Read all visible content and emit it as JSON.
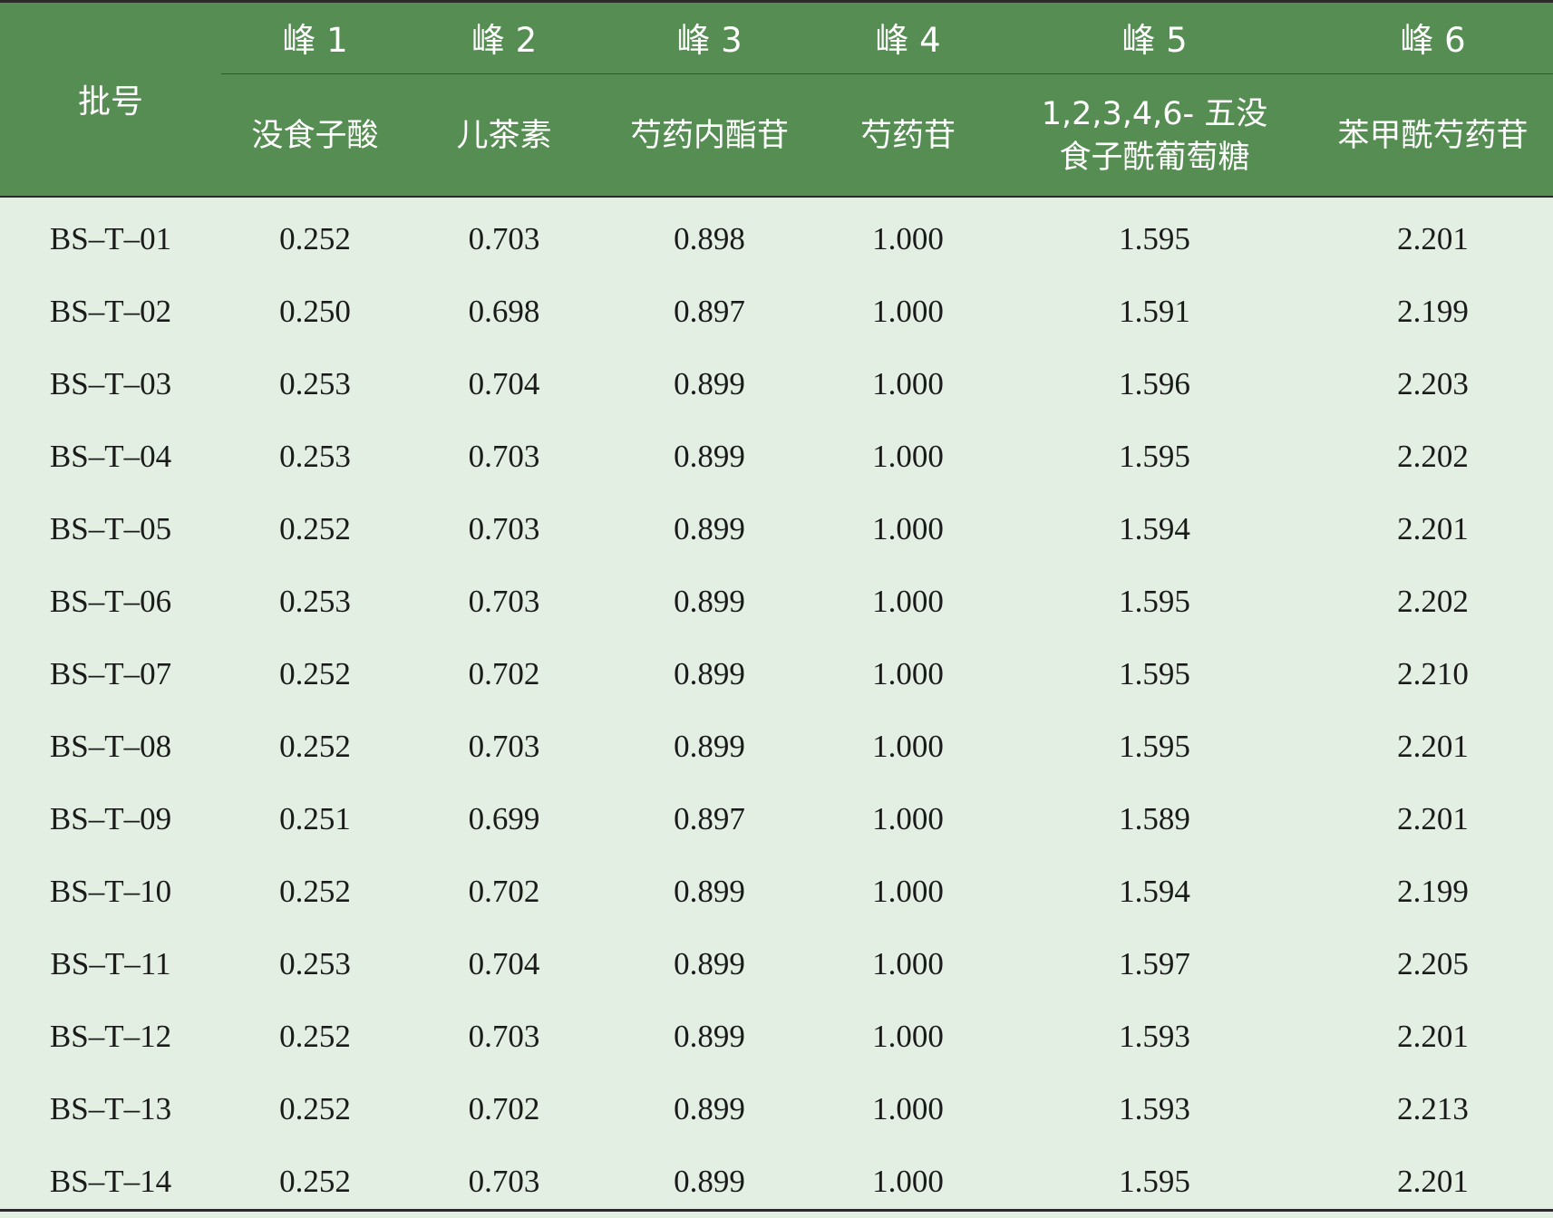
{
  "table": {
    "batch_header": "批号",
    "peaks": [
      "峰 1",
      "峰 2",
      "峰 3",
      "峰 4",
      "峰 5",
      "峰 6"
    ],
    "compounds": [
      "没食子酸",
      "儿茶素",
      "芍药内酯苷",
      "芍药苷",
      "1,2,3,4,6- 五没\n食子酰葡萄糖",
      "苯甲酰芍药苷"
    ],
    "rows": [
      [
        "BS–T–01",
        "0.252",
        "0.703",
        "0.898",
        "1.000",
        "1.595",
        "2.201"
      ],
      [
        "BS–T–02",
        "0.250",
        "0.698",
        "0.897",
        "1.000",
        "1.591",
        "2.199"
      ],
      [
        "BS–T–03",
        "0.253",
        "0.704",
        "0.899",
        "1.000",
        "1.596",
        "2.203"
      ],
      [
        "BS–T–04",
        "0.253",
        "0.703",
        "0.899",
        "1.000",
        "1.595",
        "2.202"
      ],
      [
        "BS–T–05",
        "0.252",
        "0.703",
        "0.899",
        "1.000",
        "1.594",
        "2.201"
      ],
      [
        "BS–T–06",
        "0.253",
        "0.703",
        "0.899",
        "1.000",
        "1.595",
        "2.202"
      ],
      [
        "BS–T–07",
        "0.252",
        "0.702",
        "0.899",
        "1.000",
        "1.595",
        "2.210"
      ],
      [
        "BS–T–08",
        "0.252",
        "0.703",
        "0.899",
        "1.000",
        "1.595",
        "2.201"
      ],
      [
        "BS–T–09",
        "0.251",
        "0.699",
        "0.897",
        "1.000",
        "1.589",
        "2.201"
      ],
      [
        "BS–T–10",
        "0.252",
        "0.702",
        "0.899",
        "1.000",
        "1.594",
        "2.199"
      ],
      [
        "BS–T–11",
        "0.253",
        "0.704",
        "0.899",
        "1.000",
        "1.597",
        "2.205"
      ],
      [
        "BS–T–12",
        "0.252",
        "0.703",
        "0.899",
        "1.000",
        "1.593",
        "2.201"
      ],
      [
        "BS–T–13",
        "0.252",
        "0.702",
        "0.899",
        "1.000",
        "1.593",
        "2.213"
      ],
      [
        "BS–T–14",
        "0.252",
        "0.703",
        "0.899",
        "1.000",
        "1.595",
        "2.201"
      ]
    ]
  },
  "colors": {
    "header_bg": "#568d53",
    "header_text": "#ffffff",
    "body_bg": "#e2efe2",
    "body_text": "#1a1a1a",
    "rule": "#2b2b2b"
  }
}
